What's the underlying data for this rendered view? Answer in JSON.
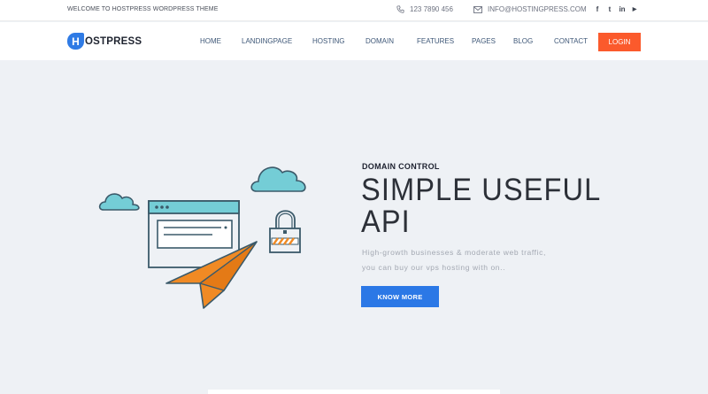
{
  "topbar": {
    "welcome": "WELCOME TO HOSTPRESS WORDPRESS THEME",
    "phone": "123 7890 456",
    "email": "INFO@HOSTINGPRESS.COM",
    "socials": [
      {
        "icon": "facebook-icon",
        "glyph": "f"
      },
      {
        "icon": "twitter-icon",
        "glyph": "t"
      },
      {
        "icon": "linkedin-icon",
        "glyph": "in"
      },
      {
        "icon": "youtube-icon",
        "glyph": "▶"
      }
    ]
  },
  "brand": {
    "badge": "H",
    "name": "OSTPRESS",
    "accent": "#2f7be5"
  },
  "nav": {
    "items": [
      "HOME",
      "LANDINGPAGE",
      "HOSTING",
      "DOMAIN",
      "FEATURES",
      "PAGES",
      "BLOG",
      "CONTACT"
    ],
    "login": "LOGIN",
    "login_color": "#fb5a2c"
  },
  "hero": {
    "eyebrow": "DOMAIN CONTROL",
    "headline_line1": "SIMPLE USEFUL",
    "headline_line2": "API",
    "subtext_line1": "High-growth businesses & moderate web traffic,",
    "subtext_line2": "you can buy our vps hosting with on..",
    "cta": "KNOW MORE",
    "cta_color": "#2b78e6"
  },
  "colors": {
    "background": "#eef1f5",
    "illustration_teal": "#74cdd6",
    "illustration_orange": "#f08a24"
  }
}
